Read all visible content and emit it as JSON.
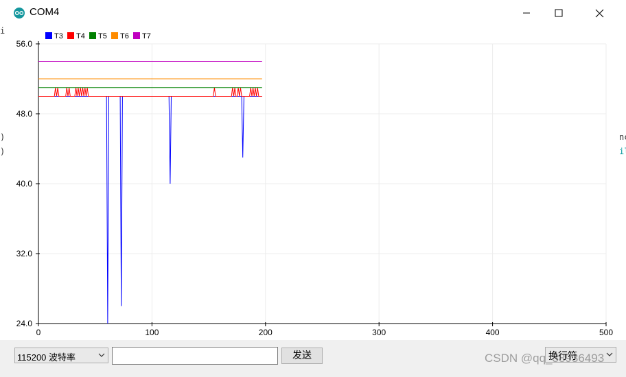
{
  "window": {
    "title": "COM4",
    "controls": [
      "minimize",
      "maximize",
      "close"
    ]
  },
  "background_editor": {
    "left_edge_chars": [
      "i",
      ")",
      ")"
    ],
    "right_edge_chars": [
      "nc",
      "il"
    ]
  },
  "chart_data": {
    "type": "line",
    "x": [
      0,
      500
    ],
    "xlim": [
      0,
      500
    ],
    "ylim": [
      24.0,
      56.0
    ],
    "x_ticks": [
      "0",
      "100",
      "200",
      "300",
      "400",
      "500"
    ],
    "y_ticks": [
      "56.0",
      "48.0",
      "40.0",
      "32.0",
      "24.0"
    ],
    "grid": true,
    "legend_placement": "top-left",
    "series": [
      {
        "name": "T3",
        "color": "#0000ff",
        "points": [
          [
            0,
            50
          ],
          [
            60,
            50
          ],
          [
            61,
            24
          ],
          [
            62,
            50
          ],
          [
            72,
            50
          ],
          [
            73,
            26
          ],
          [
            74,
            50
          ],
          [
            115,
            50
          ],
          [
            116,
            40
          ],
          [
            117,
            50
          ],
          [
            179,
            50
          ],
          [
            180,
            43
          ],
          [
            181,
            50
          ],
          [
            197,
            50
          ]
        ]
      },
      {
        "name": "T4",
        "color": "#ff0000",
        "points": [
          [
            0,
            50
          ],
          [
            14,
            50
          ],
          [
            15,
            51
          ],
          [
            16,
            50
          ],
          [
            17,
            51
          ],
          [
            18,
            50
          ],
          [
            24,
            50
          ],
          [
            25,
            51
          ],
          [
            26,
            50
          ],
          [
            27,
            51
          ],
          [
            28,
            50
          ],
          [
            32,
            50
          ],
          [
            33,
            51
          ],
          [
            34,
            50
          ],
          [
            35,
            51
          ],
          [
            36,
            50
          ],
          [
            37,
            51
          ],
          [
            38,
            50
          ],
          [
            39,
            51
          ],
          [
            40,
            50
          ],
          [
            41,
            51
          ],
          [
            42,
            50
          ],
          [
            43,
            51
          ],
          [
            44,
            50
          ],
          [
            154,
            50
          ],
          [
            155,
            51
          ],
          [
            156,
            50
          ],
          [
            170,
            50
          ],
          [
            171,
            51
          ],
          [
            172,
            50
          ],
          [
            173,
            51
          ],
          [
            174,
            50
          ],
          [
            175,
            50
          ],
          [
            176,
            51
          ],
          [
            177,
            50
          ],
          [
            178,
            51
          ],
          [
            179,
            50
          ],
          [
            186,
            50
          ],
          [
            187,
            51
          ],
          [
            188,
            50
          ],
          [
            189,
            51
          ],
          [
            190,
            50
          ],
          [
            191,
            51
          ],
          [
            192,
            50
          ],
          [
            193,
            51
          ],
          [
            194,
            50
          ],
          [
            197,
            50
          ]
        ]
      },
      {
        "name": "T5",
        "color": "#008000",
        "points": [
          [
            0,
            51
          ],
          [
            197,
            51
          ]
        ]
      },
      {
        "name": "T6",
        "color": "#ff8c00",
        "points": [
          [
            0,
            52
          ],
          [
            197,
            52
          ]
        ]
      },
      {
        "name": "T7",
        "color": "#c000c0",
        "points": [
          [
            0,
            54
          ],
          [
            197,
            54
          ]
        ]
      }
    ]
  },
  "bottom": {
    "baud": "115200  波特率",
    "message_value": "",
    "send_label": "发送",
    "line_ending": "换行符",
    "watermark": "CSDN @qq_38936493"
  }
}
